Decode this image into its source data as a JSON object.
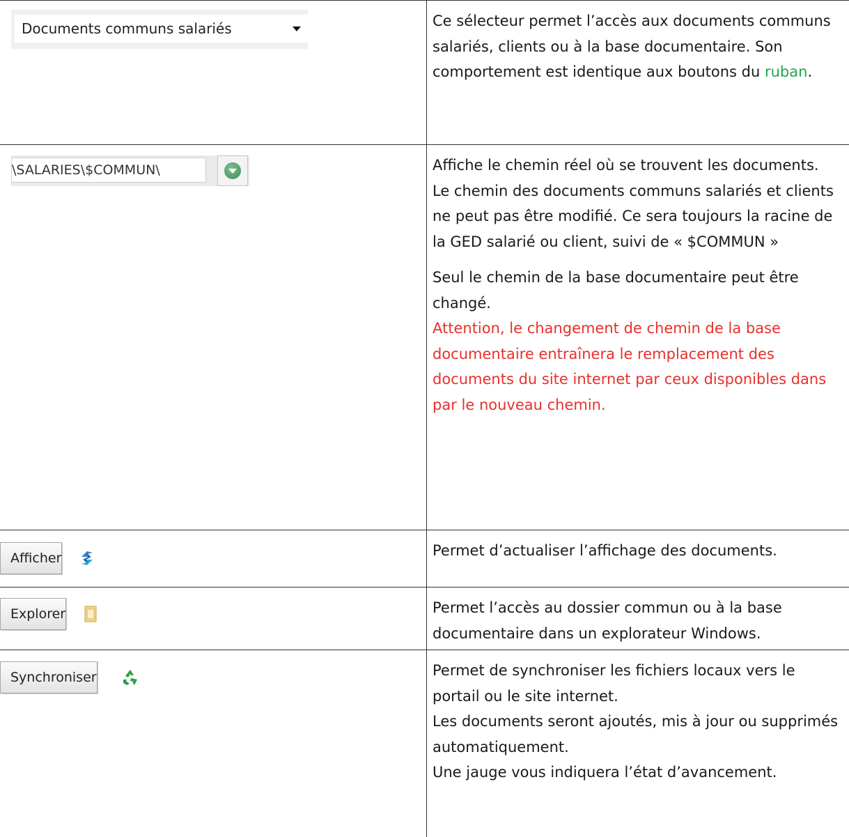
{
  "rows": [
    {
      "widget": {
        "type": "select",
        "selected": "Documents communs salariés"
      },
      "text": {
        "part1": "Ce sélecteur permet l’accès aux documents communs salariés, clients ou à la base documentaire. Son comportement est identique aux boutons du ",
        "link": "ruban",
        "part2": "."
      }
    },
    {
      "widget": {
        "type": "path-field",
        "value": "\\SALARIES\\$COMMUN\\",
        "icon": "chevron-down-circle-icon"
      },
      "text": {
        "p1": "Affiche le chemin réel où se trouvent les documents.",
        "p2": "Le chemin des documents communs salariés et clients ne peut pas être modifié. Ce sera toujours la racine de la GED salarié ou client, suivi de « $COMMUN »",
        "p3": "Seul le chemin de la base documentaire peut être changé.",
        "warning": "Attention, le changement de chemin de la base documentaire entraînera le remplacement des documents du site internet par ceux disponibles dans par le nouveau chemin."
      }
    },
    {
      "widget": {
        "type": "button",
        "label": "Afficher",
        "icon": "refresh-icon"
      },
      "text": {
        "p1": "Permet d’actualiser l’affichage des documents."
      }
    },
    {
      "widget": {
        "type": "button",
        "label": "Explorer",
        "icon": "folder-icon"
      },
      "text": {
        "p1": "Permet l’accès au dossier commun ou à la base documentaire dans un explorateur Windows."
      }
    },
    {
      "widget": {
        "type": "button",
        "label": "Synchroniser",
        "icon": "recycle-icon"
      },
      "text": {
        "p1": "Permet de synchroniser les fichiers locaux vers le portail ou le site internet.",
        "p2": "Les documents seront ajoutés, mis à jour ou supprimés automatiquement.",
        "p3": "Une jauge vous indiquera l’état d’avancement."
      }
    }
  ],
  "colors": {
    "link": "#1fa64e",
    "warning": "#e8302a",
    "border": "#333333"
  }
}
